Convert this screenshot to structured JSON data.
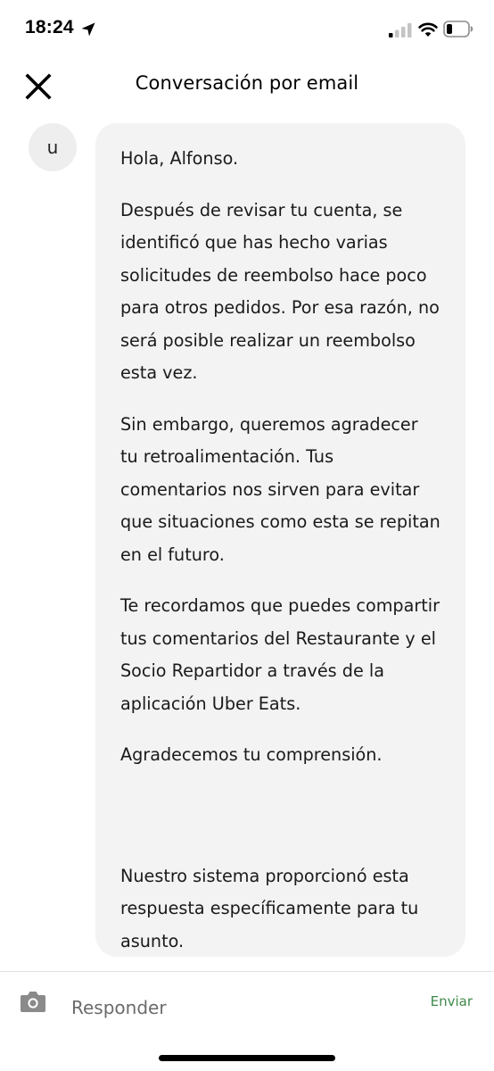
{
  "status_bar": {
    "time": "18:24",
    "icons": [
      "location-arrow-icon",
      "cellular-signal-icon",
      "wifi-icon",
      "battery-icon"
    ]
  },
  "header": {
    "title": "Conversación por email",
    "close_icon": "close-icon"
  },
  "conversation": {
    "avatar_initial": "u",
    "message": {
      "greeting": "Hola, Alfonso.",
      "paragraph_1": "Después de revisar tu cuenta, se identificó que has hecho varias solicitudes de reembolso hace poco para otros pedidos. Por esa razón, no será posible realizar un reembolso esta vez.",
      "paragraph_2": "Sin embargo, queremos agradecer tu retroalimentación. Tus comentarios nos sirven para evitar que situaciones como esta se repitan en el futuro.",
      "paragraph_3": "Te recordamos que puedes compartir tus comentarios del Restaurante y el Socio Repartidor a través de la aplicación Uber Eats.",
      "paragraph_4": "Agradecemos tu comprensión.",
      "footer_note": "Nuestro sistema proporcionó esta respuesta específicamente para tu asunto."
    }
  },
  "composer": {
    "camera_icon": "camera-icon",
    "placeholder": "Responder",
    "value": "",
    "send_label": "Enviar"
  },
  "colors": {
    "bubble_background": "#f3f3f3",
    "avatar_background": "#eeeeee",
    "send_accent": "#3f8a4a",
    "text_primary": "#1a1a1a",
    "placeholder": "#6b6b6b"
  }
}
